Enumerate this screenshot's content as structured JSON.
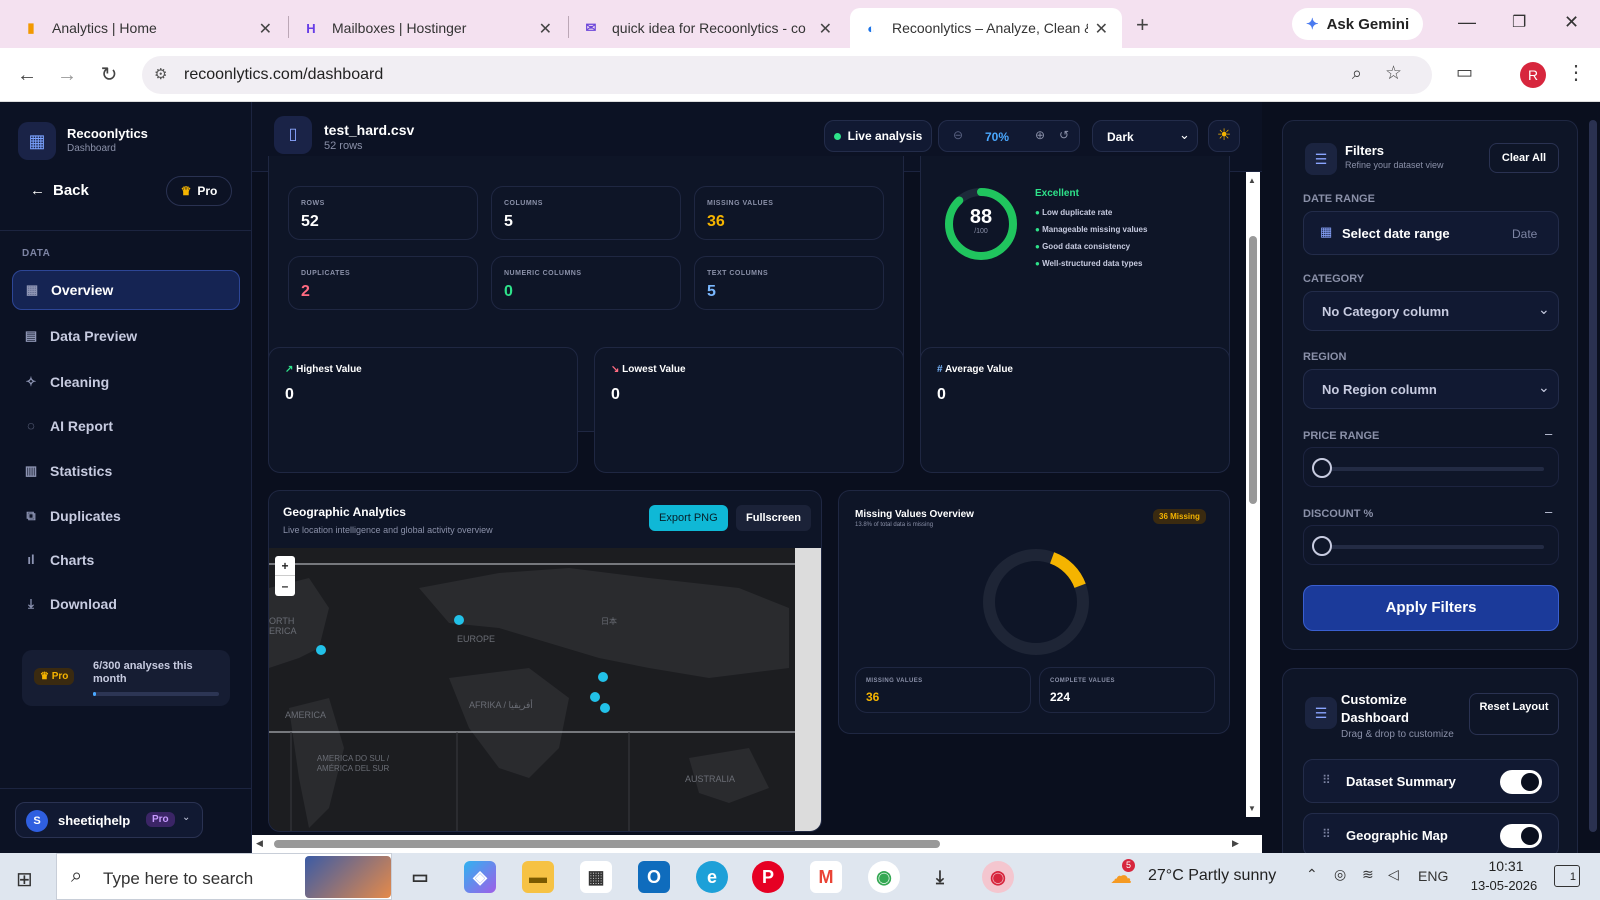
{
  "browser": {
    "tabs": [
      {
        "title": "Analytics | Home"
      },
      {
        "title": "Mailboxes | Hostinger"
      },
      {
        "title": "quick idea for Recoonlytics - co"
      },
      {
        "title": "Recoonlytics – Analyze, Clean &"
      }
    ],
    "gemini_label": "Ask Gemini",
    "url": "recoonlytics.com/dashboard",
    "profile_initial": "R"
  },
  "sidebar": {
    "brand": "Recoonlytics",
    "brand_sub": "Dashboard",
    "back_label": "Back",
    "pro_label": "Pro",
    "section_label": "DATA",
    "items": [
      {
        "label": "Overview",
        "icon": "grid-icon"
      },
      {
        "label": "Data Preview",
        "icon": "table-icon"
      },
      {
        "label": "Cleaning",
        "icon": "sparkle-icon"
      },
      {
        "label": "AI Report",
        "icon": "lightbulb-icon"
      },
      {
        "label": "Statistics",
        "icon": "stats-icon"
      },
      {
        "label": "Duplicates",
        "icon": "copy-icon"
      },
      {
        "label": "Charts",
        "icon": "bar-chart-icon"
      },
      {
        "label": "Download",
        "icon": "download-icon"
      }
    ],
    "usage": {
      "badge": "Pro",
      "text": "6/300 analyses this month",
      "progress_fraction": 0.02
    },
    "user": {
      "initial": "S",
      "name": "sheetiqhelp",
      "badge": "Pro"
    }
  },
  "topbar": {
    "file_name": "test_hard.csv",
    "file_rows": "52 rows",
    "live_label": "Live analysis",
    "zoom": "70%",
    "theme": "Dark"
  },
  "stats": [
    {
      "label": "ROWS",
      "value": "52",
      "color": "#ffffff"
    },
    {
      "label": "COLUMNS",
      "value": "5",
      "color": "#ffffff"
    },
    {
      "label": "MISSING VALUES",
      "value": "36",
      "color": "#f5b400"
    },
    {
      "label": "DUPLICATES",
      "value": "2",
      "color": "#ff6b81"
    },
    {
      "label": "NUMERIC COLUMNS",
      "value": "0",
      "color": "#2ee28a"
    },
    {
      "label": "TEXT COLUMNS",
      "value": "5",
      "color": "#7ab8ff"
    }
  ],
  "quality": {
    "score": "88",
    "score_sub": "/100",
    "score_fraction": 0.88,
    "grade": "Excellent",
    "points": [
      "Low duplicate rate",
      "Manageable missing values",
      "Good data consistency",
      "Well-structured data types"
    ]
  },
  "value_cards": [
    {
      "label": "Highest Value",
      "value": "0",
      "icon": "trend-up-icon"
    },
    {
      "label": "Lowest Value",
      "value": "0",
      "icon": "trend-down-icon"
    },
    {
      "label": "Average Value",
      "value": "0",
      "icon": "hash-icon"
    }
  ],
  "geo": {
    "title": "Geographic Analytics",
    "subtitle": "Live location intelligence and global activity overview",
    "export_label": "Export PNG",
    "fullscreen_label": "Fullscreen",
    "zoom_in": "+",
    "zoom_out": "–",
    "map_labels": [
      "ORTH ERICA",
      "EUROPE",
      "AFRIKA / أفريقيا",
      "AMERICA",
      "AMERICA DO SUL / AMÉRICA DEL SUR",
      "AUSTRALIA",
      "日本"
    ]
  },
  "missing": {
    "title": "Missing Values Overview",
    "subtitle": "13.8% of total data is missing",
    "badge": "36 Missing",
    "fraction": 0.138,
    "missing_label": "MISSING VALUES",
    "missing_value": "36",
    "complete_label": "COMPLETE VALUES",
    "complete_value": "224"
  },
  "filters": {
    "title": "Filters",
    "subtitle": "Refine your dataset view",
    "clear_label": "Clear All",
    "date_label": "DATE RANGE",
    "date_placeholder": "Select date range",
    "date_hint": "Date",
    "category_label": "CATEGORY",
    "category_value": "No Category column",
    "region_label": "REGION",
    "region_value": "No Region column",
    "price_label": "PRICE RANGE",
    "discount_label": "DISCOUNT %",
    "collapse": "–",
    "apply_label": "Apply Filters"
  },
  "customize": {
    "title": "Customize Dashboard",
    "subtitle": "Drag & drop to customize",
    "reset_label": "Reset Layout",
    "widgets": [
      {
        "label": "Dataset Summary",
        "enabled": true
      },
      {
        "label": "Geographic Map",
        "enabled": true
      }
    ]
  },
  "taskbar": {
    "search_placeholder": "Type here to search",
    "weather": "27°C  Partly sunny",
    "weather_badge": "5",
    "lang": "ENG",
    "time": "10:31",
    "date": "13-05-2026",
    "notif_count": "1"
  }
}
